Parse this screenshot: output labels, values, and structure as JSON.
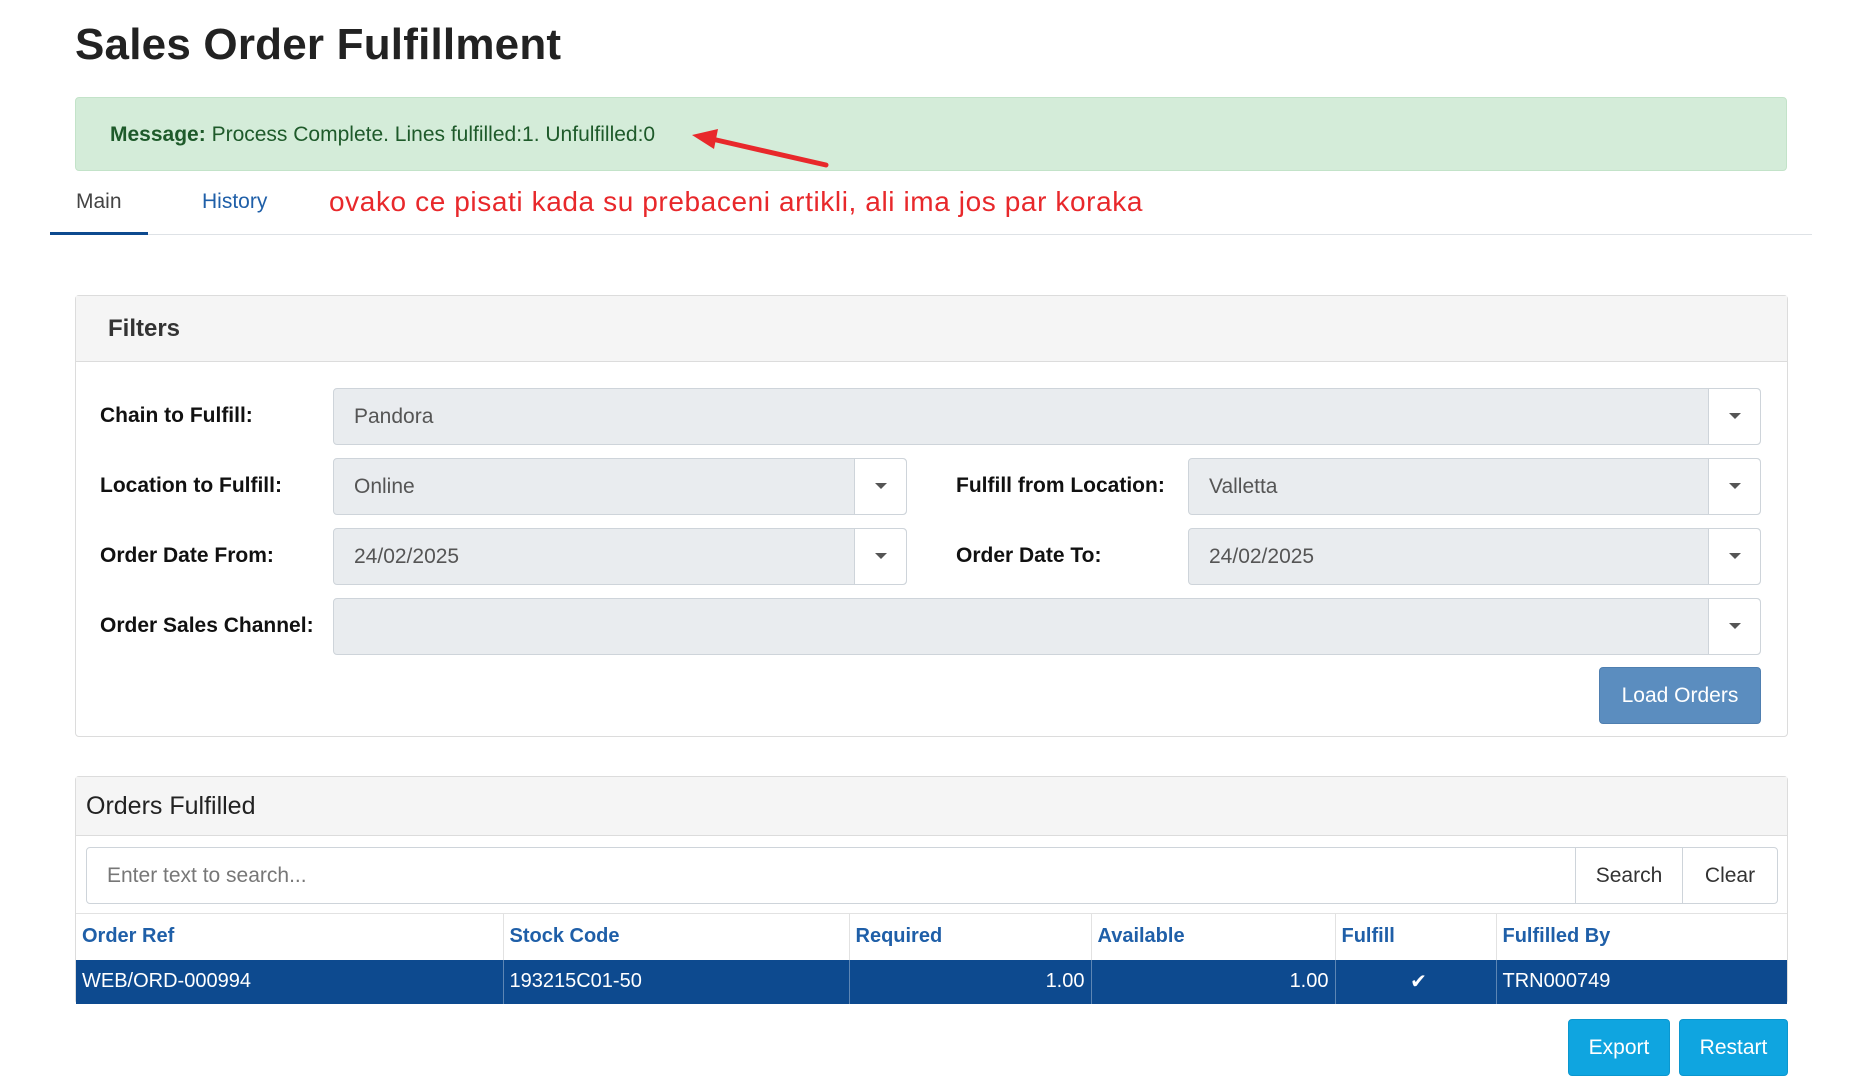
{
  "page": {
    "title": "Sales Order Fulfillment"
  },
  "alert": {
    "label": "Message:",
    "text": "Process Complete. Lines fulfilled:1. Unfulfilled:0"
  },
  "annotation": {
    "text": "ovako ce pisati kada su prebaceni artikli, ali ima jos par koraka",
    "color": "#e8282b"
  },
  "tabs": [
    {
      "label": "Main",
      "active": true
    },
    {
      "label": "History",
      "active": false
    }
  ],
  "filters": {
    "title": "Filters",
    "chain": {
      "label": "Chain to Fulfill:",
      "value": "Pandora"
    },
    "location": {
      "label": "Location to Fulfill:",
      "value": "Online"
    },
    "fulfill_from": {
      "label": "Fulfill from Location:",
      "value": "Valletta"
    },
    "date_from": {
      "label": "Order Date From:",
      "value": "24/02/2025"
    },
    "date_to": {
      "label": "Order Date To:",
      "value": "24/02/2025"
    },
    "sales_channel": {
      "label": "Order Sales Channel:",
      "value": ""
    },
    "load_button": "Load Orders"
  },
  "orders": {
    "title": "Orders Fulfilled",
    "search_placeholder": "Enter text to search...",
    "search_button": "Search",
    "clear_button": "Clear",
    "columns": [
      "Order Ref",
      "Stock Code",
      "Required",
      "Available",
      "Fulfill",
      "Fulfilled By"
    ],
    "rows": [
      {
        "order_ref": "WEB/ORD-000994",
        "stock_code": "193215C01-50",
        "required": "1.00",
        "available": "1.00",
        "fulfill": "✔",
        "fulfilled_by": "TRN000749"
      }
    ]
  },
  "actions": {
    "export": "Export",
    "restart": "Restart"
  },
  "colors": {
    "accent": "#0d4a8f",
    "alert_bg": "#d4ecd9",
    "action_button": "#0fa5e0",
    "load_button": "#5b8dbf"
  }
}
